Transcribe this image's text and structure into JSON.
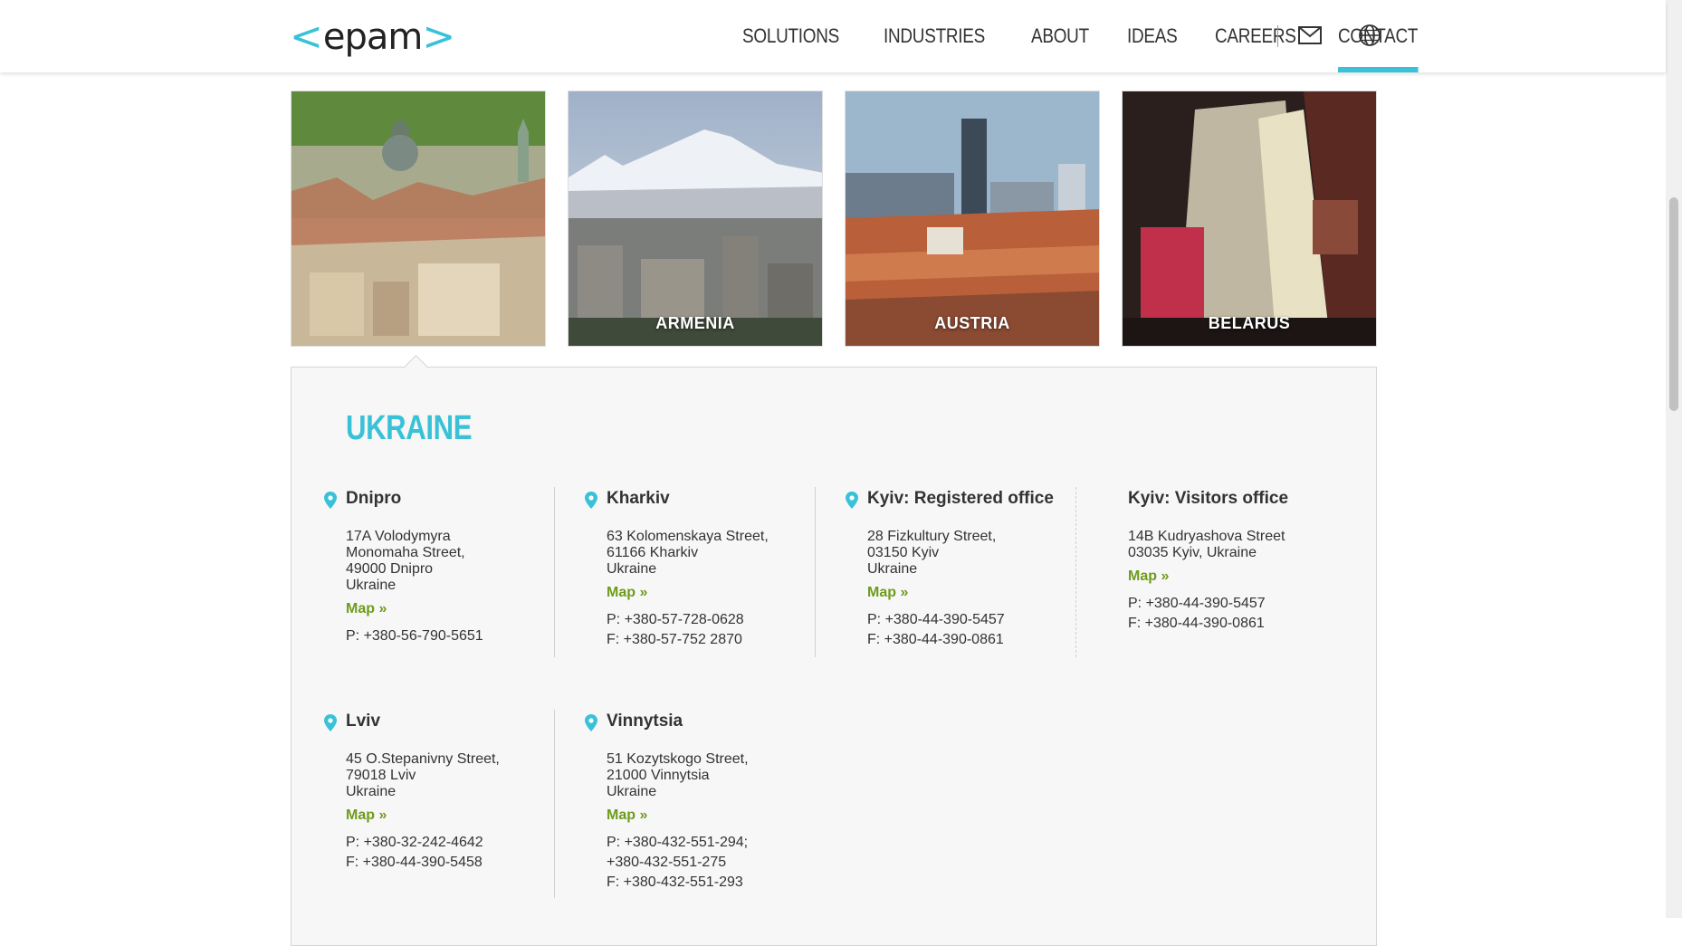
{
  "header": {
    "logo": {
      "left": "<",
      "word": "epam",
      "right": ">"
    },
    "nav": [
      {
        "label": "SOLUTIONS"
      },
      {
        "label": "INDUSTRIES"
      },
      {
        "label": "ABOUT"
      },
      {
        "label": "IDEAS"
      },
      {
        "label": "CAREERS"
      },
      {
        "label": "CONTACT",
        "active": true
      }
    ],
    "icons": [
      "mail-icon",
      "globe-icon"
    ]
  },
  "countries": [
    {
      "label": "",
      "selected": true
    },
    {
      "label": "ARMENIA"
    },
    {
      "label": "AUSTRIA"
    },
    {
      "label": "BELARUS"
    }
  ],
  "panel": {
    "title": "UKRAINE",
    "map_link": "Map »",
    "offices": [
      {
        "name": "Dnipro",
        "address": [
          "17A Volodymyra",
          "Monomaha Street,",
          "49000 Dnipro",
          "Ukraine"
        ],
        "phones": [
          "P: +380-56-790-5651"
        ]
      },
      {
        "name": "Kharkiv",
        "address": [
          "63 Kolomenskaya Street,",
          "61166 Kharkiv",
          "Ukraine"
        ],
        "phones": [
          "P: +380-57-728-0628",
          "F: +380-57-752 2870"
        ]
      },
      {
        "name": "Kyiv: Registered office",
        "address": [
          "28 Fizkultury Street,",
          "03150 Kyiv",
          "Ukraine"
        ],
        "phones": [
          "P: +380-44-390-5457",
          "F: +380-44-390-0861"
        ]
      },
      {
        "name": "Kyiv: Visitors office",
        "address": [
          "14B Kudryashova Street",
          "03035 Kyiv, Ukraine"
        ],
        "phones": [
          "P: +380-44-390-5457",
          "F: +380-44-390-0861"
        ]
      },
      {
        "name": "Lviv",
        "address": [
          "45 O.Stepanivny Street,",
          "79018 Lviv",
          "Ukraine"
        ],
        "phones": [
          "P: +380-32-242-4642",
          "F: +380-44-390-5458"
        ]
      },
      {
        "name": "Vinnytsia",
        "address": [
          "51 Kozytskogo Street,",
          "21000 Vinnytsia",
          "Ukraine"
        ],
        "phones": [
          "P: +380-432-551-294;",
          "+380-432-551-275",
          "F: +380-432-551-293"
        ]
      }
    ]
  },
  "colors": {
    "accent": "#39c2d7",
    "link": "#6f9b1c"
  }
}
